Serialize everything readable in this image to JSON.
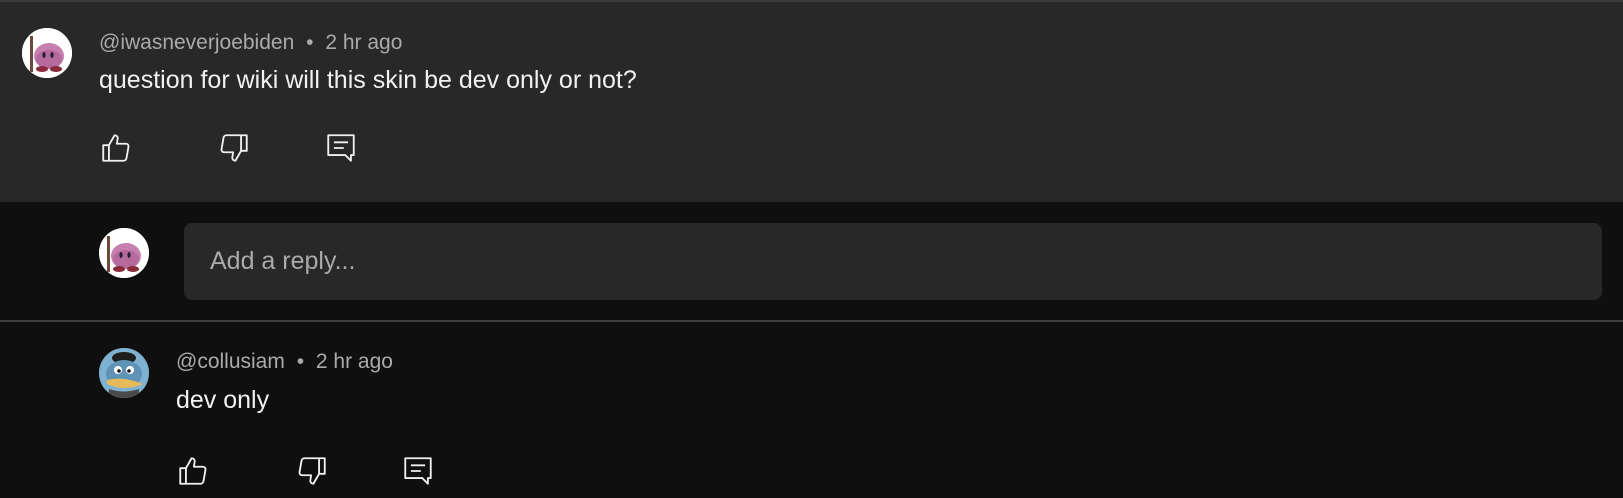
{
  "parent_comment": {
    "author": "@iwasneverjoebiden",
    "separator": "•",
    "time": "2 hr ago",
    "text": "question for wiki will this skin be dev only or not?",
    "avatar_icon": "kirby-avatar-icon"
  },
  "reply_box": {
    "placeholder": "Add a reply...",
    "avatar_icon": "kirby-avatar-icon"
  },
  "reply_comment": {
    "author": "@collusiam",
    "separator": "•",
    "time": "2 hr ago",
    "text": "dev only",
    "avatar_icon": "duck-avatar-icon"
  },
  "actions": {
    "like_icon": "thumbs-up-icon",
    "dislike_icon": "thumbs-down-icon",
    "reply_icon": "comment-reply-icon"
  },
  "colors": {
    "page_bg": "#0f0f0f",
    "card_bg": "#282828",
    "text_primary": "#f1f1f1",
    "text_secondary": "#aaaaaa"
  }
}
